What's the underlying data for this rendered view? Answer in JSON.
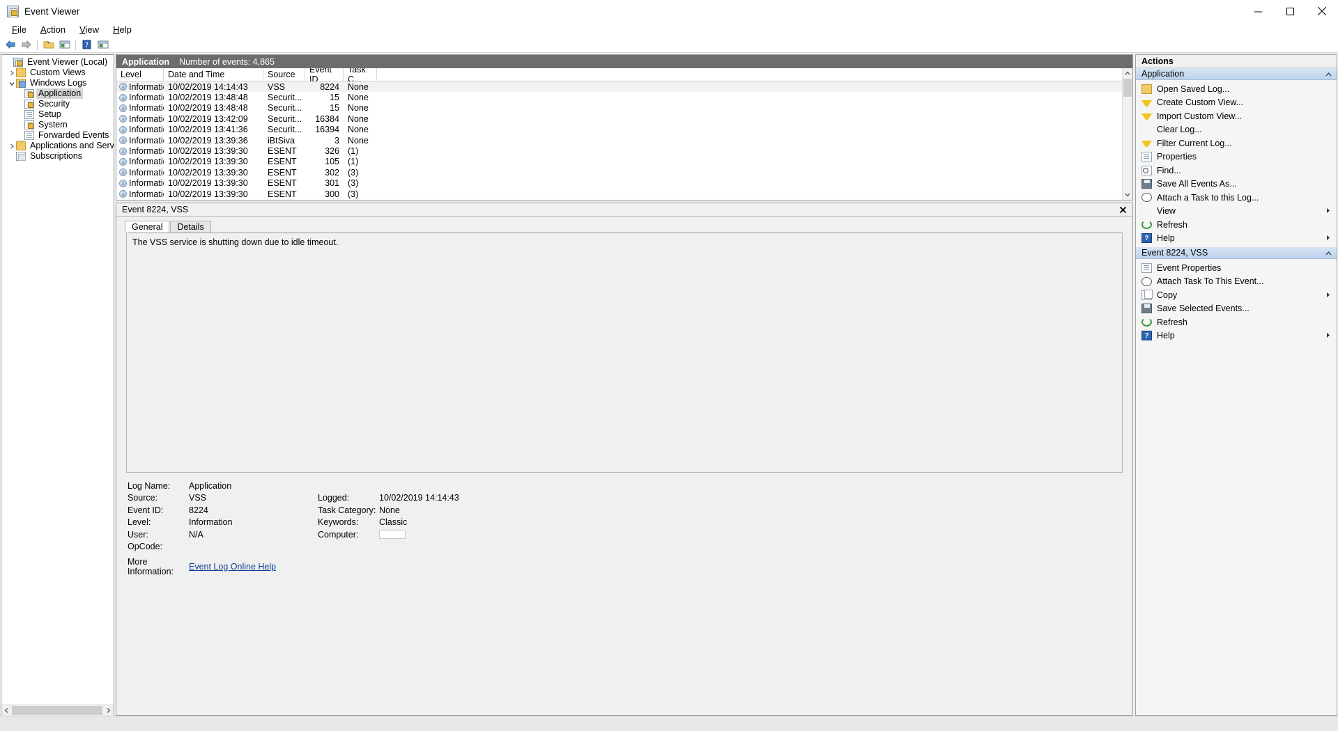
{
  "window": {
    "title": "Event Viewer",
    "icon": "event-viewer-icon",
    "minimize": "minimize-icon",
    "maximize": "maximize-icon",
    "close": "close-icon"
  },
  "menu": {
    "items": [
      {
        "label": "File",
        "accel": "F"
      },
      {
        "label": "Action",
        "accel": "A"
      },
      {
        "label": "View",
        "accel": "V"
      },
      {
        "label": "Help",
        "accel": "H"
      }
    ]
  },
  "toolbar": {
    "buttons": [
      {
        "name": "back-button",
        "icon": "left-arrow-icon"
      },
      {
        "name": "forward-button",
        "icon": "right-arrow-icon"
      },
      {
        "name": "show-hide-tree-button",
        "icon": "folder-icon"
      },
      {
        "name": "properties-button",
        "icon": "window-list-icon"
      },
      {
        "name": "help-button",
        "icon": "question-mark-icon"
      },
      {
        "name": "show-action-pane-button",
        "icon": "window-pane-icon"
      }
    ]
  },
  "tree": {
    "nodes": [
      {
        "label": "Event Viewer (Local)",
        "icon": "event-viewer-icon",
        "indent": 0,
        "twisty": "none",
        "selected": false
      },
      {
        "label": "Custom Views",
        "icon": "custom-views-folder-icon",
        "indent": 1,
        "twisty": "collapsed",
        "selected": false
      },
      {
        "label": "Windows Logs",
        "icon": "windows-logs-folder-icon",
        "indent": 1,
        "twisty": "expanded",
        "selected": false
      },
      {
        "label": "Application",
        "icon": "log-warn-icon",
        "indent": 2,
        "twisty": "none",
        "selected": true
      },
      {
        "label": "Security",
        "icon": "log-warn-icon",
        "indent": 2,
        "twisty": "none",
        "selected": false
      },
      {
        "label": "Setup",
        "icon": "log-icon",
        "indent": 2,
        "twisty": "none",
        "selected": false
      },
      {
        "label": "System",
        "icon": "log-warn-icon",
        "indent": 2,
        "twisty": "none",
        "selected": false
      },
      {
        "label": "Forwarded Events",
        "icon": "log-icon",
        "indent": 2,
        "twisty": "none",
        "selected": false
      },
      {
        "label": "Applications and Services Lo",
        "icon": "services-folder-icon",
        "indent": 1,
        "twisty": "collapsed",
        "selected": false
      },
      {
        "label": "Subscriptions",
        "icon": "subscriptions-icon",
        "indent": 1,
        "twisty": "none",
        "selected": false
      }
    ]
  },
  "list": {
    "header": {
      "log_name": "Application",
      "count_text": "Number of events: 4,865"
    },
    "columns": [
      "Level",
      "Date and Time",
      "Source",
      "Event ID",
      "Task C..."
    ],
    "rows": [
      {
        "level": "Information",
        "datetime": "10/02/2019 14:14:43",
        "source": "VSS",
        "event_id": "8224",
        "task": "None",
        "selected": true
      },
      {
        "level": "Information",
        "datetime": "10/02/2019 13:48:48",
        "source": "Securit...",
        "event_id": "15",
        "task": "None",
        "selected": false
      },
      {
        "level": "Information",
        "datetime": "10/02/2019 13:48:48",
        "source": "Securit...",
        "event_id": "15",
        "task": "None",
        "selected": false
      },
      {
        "level": "Information",
        "datetime": "10/02/2019 13:42:09",
        "source": "Securit...",
        "event_id": "16384",
        "task": "None",
        "selected": false
      },
      {
        "level": "Information",
        "datetime": "10/02/2019 13:41:36",
        "source": "Securit...",
        "event_id": "16394",
        "task": "None",
        "selected": false
      },
      {
        "level": "Information",
        "datetime": "10/02/2019 13:39:36",
        "source": "iBtSiva",
        "event_id": "3",
        "task": "None",
        "selected": false
      },
      {
        "level": "Information",
        "datetime": "10/02/2019 13:39:30",
        "source": "ESENT",
        "event_id": "326",
        "task": "(1)",
        "selected": false
      },
      {
        "level": "Information",
        "datetime": "10/02/2019 13:39:30",
        "source": "ESENT",
        "event_id": "105",
        "task": "(1)",
        "selected": false
      },
      {
        "level": "Information",
        "datetime": "10/02/2019 13:39:30",
        "source": "ESENT",
        "event_id": "302",
        "task": "(3)",
        "selected": false
      },
      {
        "level": "Information",
        "datetime": "10/02/2019 13:39:30",
        "source": "ESENT",
        "event_id": "301",
        "task": "(3)",
        "selected": false
      },
      {
        "level": "Information",
        "datetime": "10/02/2019 13:39:30",
        "source": "ESENT",
        "event_id": "300",
        "task": "(3)",
        "selected": false
      }
    ]
  },
  "detail": {
    "title": "Event 8224, VSS",
    "close_icon": "close-icon",
    "tabs": [
      {
        "label": "General",
        "active": true
      },
      {
        "label": "Details",
        "active": false
      }
    ],
    "message": "The VSS service is shutting down due to idle timeout.",
    "fields": {
      "log_name_label": "Log Name:",
      "log_name_value": "Application",
      "source_label": "Source:",
      "source_value": "VSS",
      "logged_label": "Logged:",
      "logged_value": "10/02/2019 14:14:43",
      "event_id_label": "Event ID:",
      "event_id_value": "8224",
      "task_category_label": "Task Category:",
      "task_category_value": "None",
      "level_label": "Level:",
      "level_value": "Information",
      "keywords_label": "Keywords:",
      "keywords_value": "Classic",
      "user_label": "User:",
      "user_value": "N/A",
      "computer_label": "Computer:",
      "computer_value": "",
      "opcode_label": "OpCode:",
      "opcode_value": "",
      "more_info_label": "More Information:",
      "more_info_link": "Event Log Online Help"
    }
  },
  "actions": {
    "title": "Actions",
    "groups": [
      {
        "name": "Application",
        "collapse_icon": "collapse-caret-icon",
        "items": [
          {
            "label": "Open Saved Log...",
            "icon": "open-folder-icon",
            "submenu": false
          },
          {
            "label": "Create Custom View...",
            "icon": "funnel-icon",
            "submenu": false
          },
          {
            "label": "Import Custom View...",
            "icon": "funnel-icon",
            "submenu": false
          },
          {
            "label": "Clear Log...",
            "icon": "none",
            "submenu": false
          },
          {
            "label": "Filter Current Log...",
            "icon": "funnel-icon",
            "submenu": false
          },
          {
            "label": "Properties",
            "icon": "properties-icon",
            "submenu": false
          },
          {
            "label": "Find...",
            "icon": "find-icon",
            "submenu": false
          },
          {
            "label": "Save All Events As...",
            "icon": "save-icon",
            "submenu": false
          },
          {
            "label": "Attach a Task to this Log...",
            "icon": "clock-icon",
            "submenu": false
          },
          {
            "label": "View",
            "icon": "none",
            "submenu": true
          },
          {
            "label": "Refresh",
            "icon": "refresh-icon",
            "submenu": false
          },
          {
            "label": "Help",
            "icon": "help-icon",
            "submenu": true
          }
        ]
      },
      {
        "name": "Event 8224, VSS",
        "collapse_icon": "collapse-caret-icon",
        "items": [
          {
            "label": "Event Properties",
            "icon": "properties-icon",
            "submenu": false
          },
          {
            "label": "Attach Task To This Event...",
            "icon": "clock-icon",
            "submenu": false
          },
          {
            "label": "Copy",
            "icon": "copy-icon",
            "submenu": true
          },
          {
            "label": "Save Selected Events...",
            "icon": "save-icon",
            "submenu": false
          },
          {
            "label": "Refresh",
            "icon": "refresh-icon",
            "submenu": false
          },
          {
            "label": "Help",
            "icon": "help-icon",
            "submenu": true
          }
        ]
      }
    ]
  },
  "colors": {
    "header_bar": "#6d6d6d",
    "group_header": "#bcd3ec",
    "link": "#0b3d91",
    "selection": "#d6d6d6"
  }
}
